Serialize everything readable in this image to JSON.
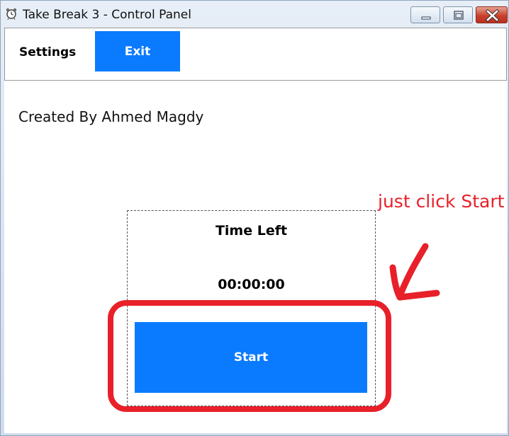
{
  "window": {
    "title": "Take Break 3 - Control Panel",
    "icon": "alarm-clock-icon"
  },
  "titlebar_buttons": {
    "minimize": "minimize-icon",
    "maximize": "maximize-icon",
    "close": "close-icon"
  },
  "menu": {
    "settings_label": "Settings",
    "exit_label": "Exit"
  },
  "credit": "Created By Ahmed Magdy",
  "timer": {
    "heading": "Time Left",
    "value": "00:00:00",
    "start_label": "Start"
  },
  "annotation": {
    "text": "just click Start",
    "color": "#e8202a"
  },
  "colors": {
    "accent": "#0a7bff",
    "annotation": "#e8202a"
  }
}
